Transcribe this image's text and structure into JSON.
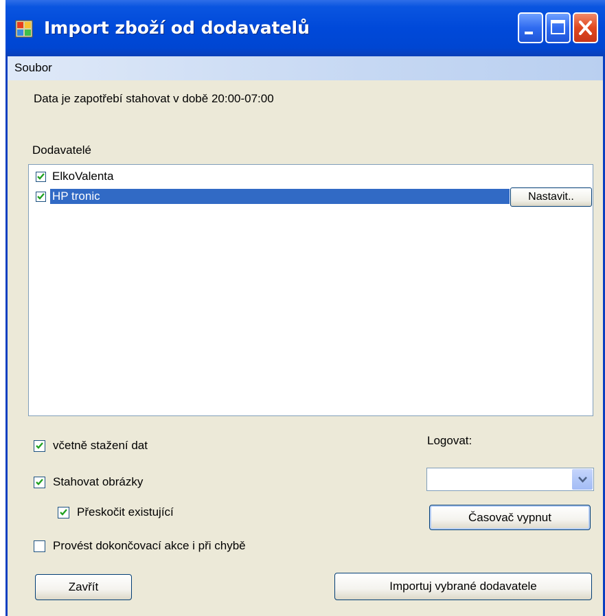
{
  "window": {
    "title": "Import zboží od dodavatelů",
    "icon": "app-window-icon"
  },
  "menu": {
    "items": [
      "Soubor"
    ]
  },
  "info_text": "Data je zapotřebí stahovat v době 20:00-07:00",
  "suppliers": {
    "label": "Dodavatelé",
    "items": [
      {
        "label": "ElkoValenta",
        "checked": true,
        "selected": false
      },
      {
        "label": "HP tronic",
        "checked": true,
        "selected": true
      }
    ],
    "settings_button": "Nastavit.."
  },
  "options": {
    "include_download": {
      "label": "včetně stažení dat",
      "checked": true
    },
    "download_images": {
      "label": "Stahovat obrázky",
      "checked": true
    },
    "skip_existing": {
      "label": "Přeskočit existující",
      "checked": true
    },
    "finalize_on_error": {
      "label": "Provést dokončovací akce i při chybě",
      "checked": false
    }
  },
  "logging": {
    "label": "Logovat:",
    "value": ""
  },
  "buttons": {
    "timer": "Časovač vypnut",
    "close": "Zavřít",
    "import": "Importuj vybrané dodavatele"
  },
  "colors": {
    "titlebar": "#0049d9",
    "selection": "#316ac5",
    "dialog_background": "#ece9d8",
    "checkmark": "#21a121",
    "close_button": "#e0481f"
  }
}
